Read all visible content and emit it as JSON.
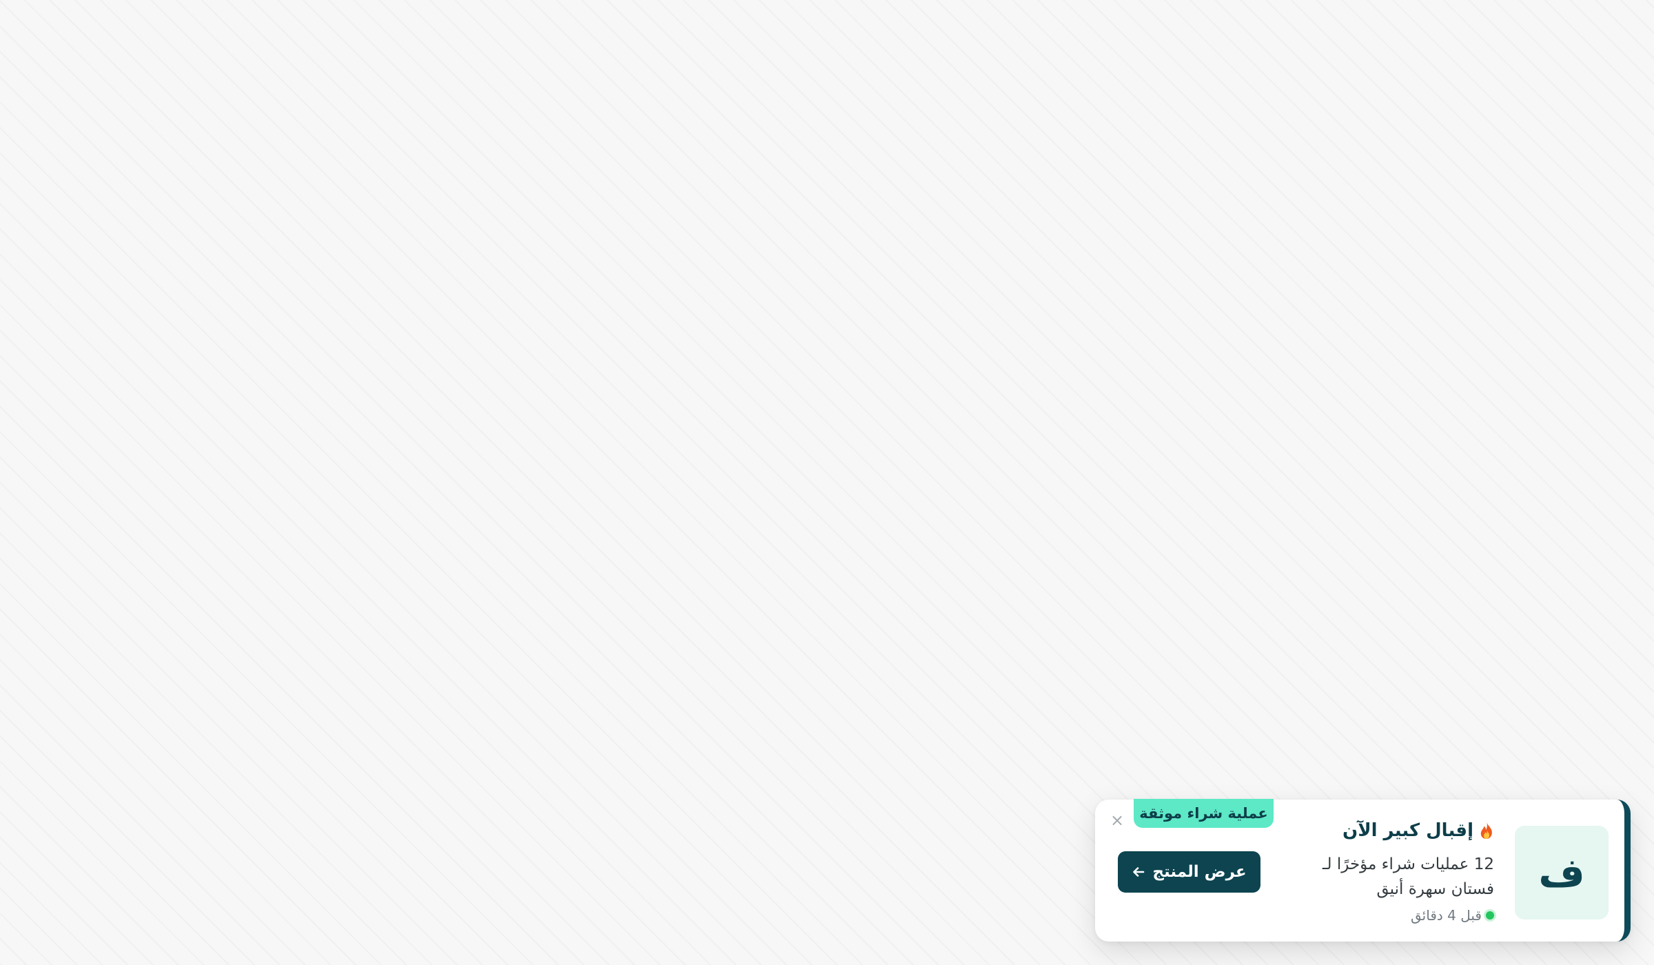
{
  "toast": {
    "badge": "عملية شراء موثقة",
    "close_glyph": "×",
    "thumbnail_letter": "ف",
    "headline": "إقبال كبير الآن",
    "fire_emoji_icon": "fire-icon",
    "body": "12 عمليات شراء مؤخرًا لـ فستان سهرة أنيق",
    "time": "قبل 4 دقائق",
    "button_label": "عرض المنتج",
    "colors": {
      "accent": "#0d4450",
      "badge_bg": "#5de8c6",
      "live_dot": "#22c55e",
      "thumb_bg": "#e6f6f1"
    }
  }
}
